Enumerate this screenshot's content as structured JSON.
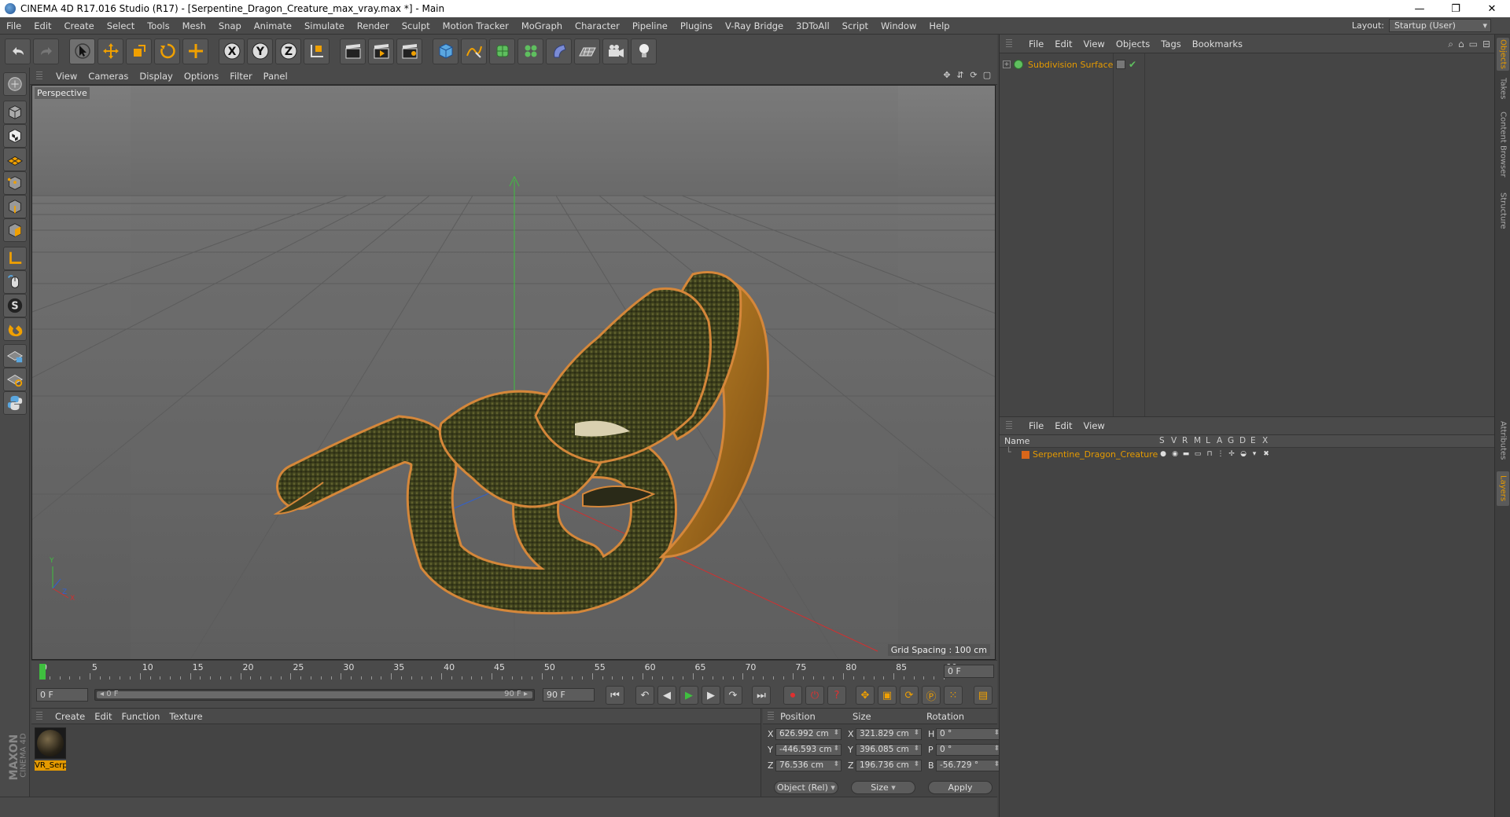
{
  "window": {
    "title": "CINEMA 4D R17.016 Studio (R17) - [Serpentine_Dragon_Creature_max_vray.max *] - Main",
    "controls": [
      "—",
      "❐",
      "✕"
    ]
  },
  "menubar": {
    "items": [
      "File",
      "Edit",
      "Create",
      "Select",
      "Tools",
      "Mesh",
      "Snap",
      "Animate",
      "Simulate",
      "Render",
      "Sculpt",
      "Motion Tracker",
      "MoGraph",
      "Character",
      "Pipeline",
      "Plugins",
      "V-Ray Bridge",
      "3DToAll",
      "Script",
      "Window",
      "Help"
    ],
    "layout_label": "Layout:",
    "layout_value": "Startup (User)"
  },
  "viewport": {
    "menu": [
      "View",
      "Cameras",
      "Display",
      "Options",
      "Filter",
      "Panel"
    ],
    "label": "Perspective",
    "grid_spacing": "Grid Spacing : 100 cm",
    "axis_labels": {
      "y": "Y",
      "x": "X",
      "z": "Z"
    }
  },
  "timeline": {
    "ticks": [
      "0",
      "5",
      "10",
      "15",
      "20",
      "25",
      "30",
      "35",
      "40",
      "45",
      "50",
      "55",
      "60",
      "65",
      "70",
      "75",
      "80",
      "85",
      "90"
    ],
    "current_frame": "0 F",
    "start_field": "0 F",
    "range_start": "◂ 0 F",
    "range_end": "90 F ▸",
    "end_field": "90 F"
  },
  "material_panel": {
    "menu": [
      "Create",
      "Edit",
      "Function",
      "Texture"
    ],
    "material_name": "VR_Serp",
    "brand": "MAXON",
    "brand_sub": "CINEMA 4D"
  },
  "coordinates": {
    "headers": {
      "position": "Position",
      "size": "Size",
      "rotation": "Rotation"
    },
    "rows": [
      {
        "axis": "X",
        "pos": "626.992 cm",
        "size_axis": "X",
        "size": "321.829 cm",
        "rot_axis": "H",
        "rot": "0 °"
      },
      {
        "axis": "Y",
        "pos": "-446.593 cm",
        "size_axis": "Y",
        "size": "396.085 cm",
        "rot_axis": "P",
        "rot": "0 °"
      },
      {
        "axis": "Z",
        "pos": "76.536 cm",
        "size_axis": "Z",
        "size": "196.736 cm",
        "rot_axis": "B",
        "rot": "-56.729 °"
      }
    ],
    "mode_dropdown": "Object (Rel)",
    "size_dropdown": "Size",
    "apply_label": "Apply"
  },
  "object_manager": {
    "menu": [
      "File",
      "Edit",
      "View",
      "Objects",
      "Tags",
      "Bookmarks"
    ],
    "objects": [
      {
        "name": "Subdivision Surface"
      }
    ]
  },
  "layer_manager": {
    "menu": [
      "File",
      "Edit",
      "View"
    ],
    "header_name": "Name",
    "columns": [
      "S",
      "V",
      "R",
      "M",
      "L",
      "A",
      "G",
      "D",
      "E",
      "X"
    ],
    "layers": [
      {
        "name": "Serpentine_Dragon_Creature",
        "color": "#d9661a"
      }
    ]
  },
  "side_tabs": [
    "Objects",
    "Takes",
    "Content Browser",
    "Structure",
    "Attributes",
    "Layers"
  ],
  "colors": {
    "accent": "#e59a00",
    "panel": "#4a4a4a",
    "viewport_bg": "#6e6e6e"
  }
}
